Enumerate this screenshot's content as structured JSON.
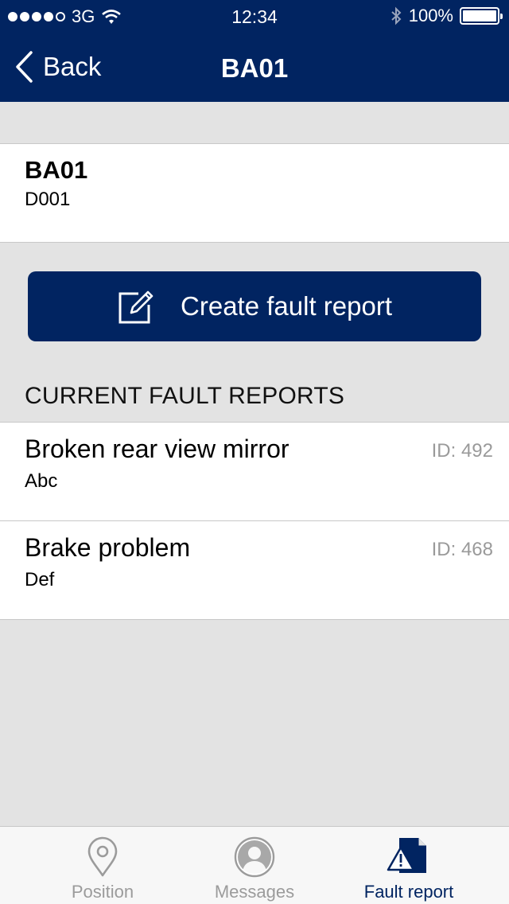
{
  "status_bar": {
    "carrier": "3G",
    "time": "12:34",
    "battery": "100%"
  },
  "nav": {
    "back_label": "Back",
    "title": "BA01"
  },
  "vehicle": {
    "name": "BA01",
    "code": "D001"
  },
  "create_button": {
    "label": "Create fault report"
  },
  "section": {
    "title": "CURRENT FAULT REPORTS"
  },
  "reports": [
    {
      "title": "Broken rear view mirror",
      "sub": "Abc",
      "id": "ID: 492"
    },
    {
      "title": "Brake problem",
      "sub": "Def",
      "id": "ID: 468"
    }
  ],
  "tabs": [
    {
      "label": "Position",
      "icon": "location-pin-icon"
    },
    {
      "label": "Messages",
      "icon": "person-icon"
    },
    {
      "label": "Fault report",
      "icon": "warning-document-icon"
    }
  ],
  "colors": {
    "brand": "#012461",
    "inactive_tab": "#9b9b9b",
    "background": "#e3e3e3"
  }
}
